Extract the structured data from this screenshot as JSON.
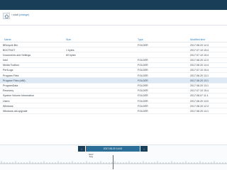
{
  "path": {
    "prefix": "\\",
    "current": "sda8",
    "change_label": "change"
  },
  "table": {
    "headers": {
      "name": "Name",
      "size": "Size",
      "type": "Type",
      "modified": "Modified time"
    },
    "rows": [
      {
        "name": "$Recycle.Bin",
        "size": "",
        "type": "FOLDER",
        "modified": "2017.08.20 12:3",
        "selected": false
      },
      {
        "name": "BOOTNXT",
        "size": "1 bytes",
        "type": "",
        "modified": "2017.07.10 15:4",
        "selected": false
      },
      {
        "name": "Documents and Settings",
        "size": "60 bytes",
        "type": "",
        "modified": "2017.07.10 15:4",
        "selected": false
      },
      {
        "name": "Intel",
        "size": "",
        "type": "FOLDER",
        "modified": "2017.08.20 12:3",
        "selected": false
      },
      {
        "name": "Media Toolbox",
        "size": "",
        "type": "FOLDER",
        "modified": "2017.08.20 14:4",
        "selected": false
      },
      {
        "name": "PerfLogs",
        "size": "",
        "type": "FOLDER",
        "modified": "2017.07.10 15:4",
        "selected": false
      },
      {
        "name": "Program Files",
        "size": "",
        "type": "FOLDER",
        "modified": "2017.08.20 13:1",
        "selected": false
      },
      {
        "name": "Program Files (x86)",
        "size": "",
        "type": "FOLDER",
        "modified": "2017.08.20 13:1",
        "selected": true
      },
      {
        "name": "ProgramData",
        "size": "",
        "type": "FOLDER",
        "modified": "2017.08.20 13:1",
        "selected": false
      },
      {
        "name": "Recovery",
        "size": "",
        "type": "FOLDER",
        "modified": "2017.07.10 15:4",
        "selected": false
      },
      {
        "name": "System Volume Information",
        "size": "",
        "type": "FOLDER",
        "modified": "2017.08.07 11:1",
        "selected": false
      },
      {
        "name": "Users",
        "size": "",
        "type": "FOLDER",
        "modified": "2017.08.20 13:0",
        "selected": false
      },
      {
        "name": "Windows",
        "size": "",
        "type": "FOLDER",
        "modified": "2017.08.20 12:3",
        "selected": false
      },
      {
        "name": "Windows.old.upgrade",
        "size": "",
        "type": "FOLDER",
        "modified": "2017.08.20 14:1",
        "selected": false
      }
    ]
  },
  "timeline": {
    "label": "2017.08.20 14:03",
    "prev_icon": "chevron-left-icon",
    "next_icon": "chevron-right-icon",
    "year_line1": "2017",
    "year_line2": "Aug"
  },
  "colors": {
    "topbar": "#183f57",
    "accent": "#2b7bb9",
    "selected_row": "#dde9f5",
    "marker": "#e0302f"
  }
}
